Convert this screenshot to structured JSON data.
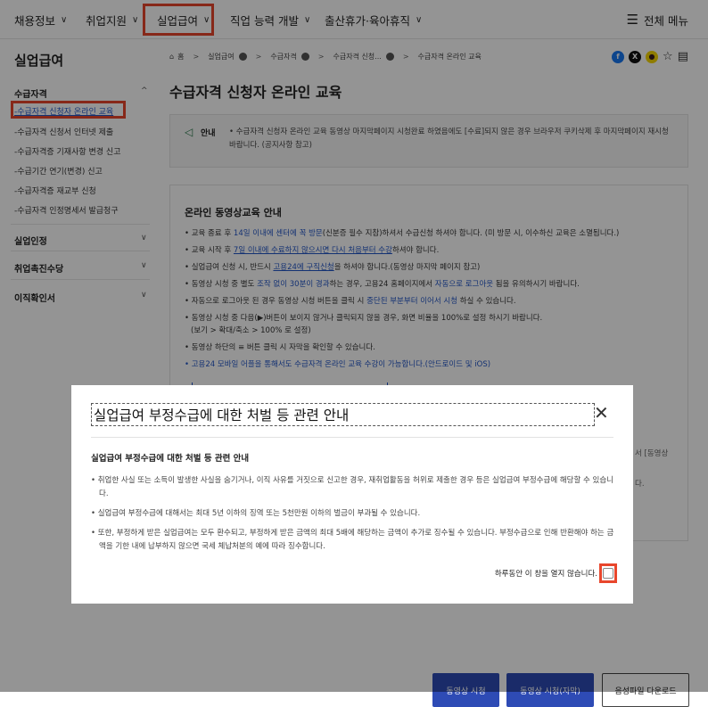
{
  "nav": {
    "items": [
      {
        "label": "채용정보",
        "chev": "∨"
      },
      {
        "label": "취업지원",
        "chev": "∨"
      },
      {
        "label": "실업급여",
        "chev": "∨"
      },
      {
        "label": "직업 능력 개발",
        "chev": "∨"
      },
      {
        "label": "출산휴가·육아휴직",
        "chev": "∨"
      }
    ],
    "all_menu": "전체 메뉴"
  },
  "sidebar": {
    "title": "실업급여",
    "section1": "수급자격",
    "items": [
      "-수급자격 신청자 온라인 교육",
      "-수급자격 신청서 인터넷 제출",
      "-수급자격증 기재사항 변경 신고",
      "-수급기간 연기(변경) 신고",
      "-수급자격증 재교부 신청",
      "-수급자격 인정명세서 발급청구"
    ],
    "section2": "실업인정",
    "section3": "취업촉진수당",
    "section4": "이직확인서",
    "caret_up": "^",
    "caret_down": "∨"
  },
  "breadcrumb": {
    "home": "홈",
    "b1": "실업급여",
    "b2": "수급자격",
    "b3": "수급자격 신청...",
    "b4": "수급자격 온라인 교육",
    "sep": ">"
  },
  "page_title": "수급자격 신청자 온라인 교육",
  "notice": {
    "label": "안내",
    "text": "• 수급자격 신청자 온라인 교육 동영상 마지막페이지 시청완료 하였음에도 [수료]되지 않은 경우 브라우저 쿠키삭제 후 마지막페이지 재시청 바랍니다. (공지사항 참고)"
  },
  "content": {
    "title": "온라인 동영상교육 안내",
    "l1a": "• 교육 종료 후 ",
    "l1b": "14일 이내에 센터에 꼭 방문",
    "l1c": "(신분증 필수 지참)하셔서 수급신청 하셔야 합니다. (미 방문 시, 이수하신 교육은 소멸됩니다.)",
    "l2a": "• 교육 시작 후 ",
    "l2b": "7일 이내에 수료하지 않으시면 다시 처음부터 수강",
    "l2c": "하셔야 합니다.",
    "l3a": "• 실업급여 신청 시, 반드시 ",
    "l3b": "고용24에 구직신청",
    "l3c": "을 하셔야 합니다.(동영상 마지막 페이지 참고)",
    "l4a": "• 동영상 시청 중 별도 ",
    "l4b": "조작 없이 30분이 경과",
    "l4c": "하는 경우, 고용24 홈페이지에서 ",
    "l4d": "자동으로 로그아웃",
    "l4e": " 됨을 유의하시기 바랍니다.",
    "l5a": "• 자동으로 로그아웃 된 경우 동영상 시청 버튼을 클릭 시 ",
    "l5b": "중단된 부분부터 이어서 시청",
    "l5c": " 하실 수 있습니다.",
    "l6": "• 동영상 시청 중 다음(▶)버튼이 보이지 않거나 클릭되지 않을 경우, 화면 비율을 100%로 설정 하시기 바랍니다.",
    "l6b": "(보기 > 확대/축소 > 100% 로 설정)",
    "l7": "• 동영상 하단의 ≡ 버튼 클릭 시 자막을 확인할 수 있습니다.",
    "l8": "• 고용24 모바일 어플을 통해서도 수급자격 온라인 교육 수강이 가능합니다.(안드로이드 및 iOS)",
    "right_frag1": "서 [동영상",
    "right_frag2": "다."
  },
  "buttons": {
    "video": "동영상 시청",
    "video_caption": "동영상 시청(자막)",
    "audio": "음성파일 다운로드"
  },
  "modal": {
    "title": "실업급여 부정수급에 대한 처벌 등 관련 안내",
    "subtitle": "실업급여 부정수급에 대한 처벌 등 관련 안내",
    "items": [
      "• 취업한 사실 또는 소득이 발생한 사실을 숨기거나, 이직 사유를 거짓으로 신고한 경우, 재취업활동을 허위로 제출한 경우 등은 실업급여 부정수급에 해당할 수 있습니다.",
      "• 실업급여 부정수급에 대해서는 최대 5년 이하의 징역 또는 5천만원 이하의 벌금이 부과될 수 있습니다.",
      "• 또한, 부정하게 받은 실업급여는 모두 환수되고, 부정하게 받은 금액의 최대 5배에 해당하는 금액이 추가로 징수될 수 있습니다. 부정수급으로 인해 반환해야 하는 금액을 기한 내에 납부하지 않으면 국세 체납처분의 예에 따라 징수합니다."
    ],
    "dont_show": "하루동안 이 창을 열지 않습니다.",
    "close": "✕"
  },
  "colors": {
    "highlight": "#e8462c",
    "link": "#2456c7",
    "primary_button": "#2e4bb5"
  }
}
